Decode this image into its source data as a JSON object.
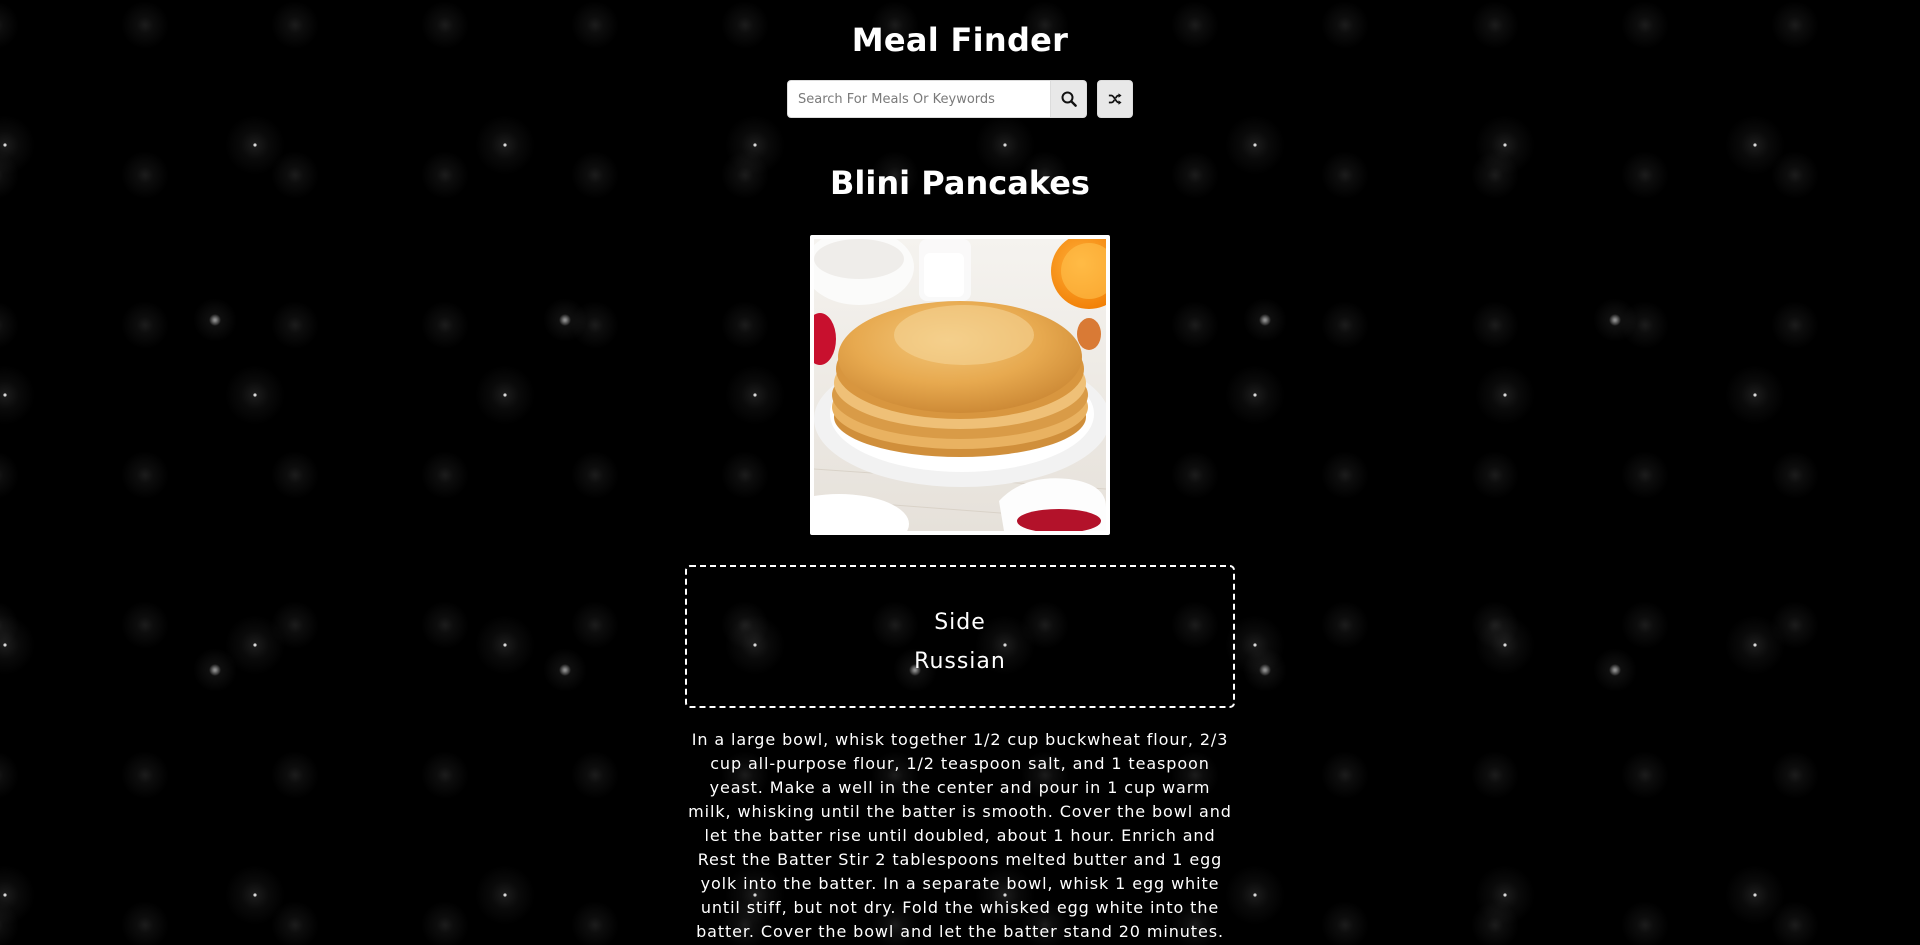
{
  "header": {
    "title": "Meal Finder"
  },
  "search": {
    "placeholder": "Search For Meals Or Keywords",
    "value": "",
    "submit_icon": "search-icon",
    "random_icon": "shuffle-icon"
  },
  "meal": {
    "name": "Blini Pancakes",
    "image_alt": "Blini Pancakes",
    "category": "Side",
    "area": "Russian",
    "instructions": "In a large bowl, whisk together 1/2 cup buckwheat flour, 2/3 cup all-purpose flour, 1/2 teaspoon salt, and 1 teaspoon yeast. Make a well in the center and pour in 1 cup warm milk, whisking until the batter is smooth. Cover the bowl and let the batter rise until doubled, about 1 hour. Enrich and Rest the Batter Stir 2 tablespoons melted butter and 1 egg yolk into the batter. In a separate bowl, whisk 1 egg white until stiff, but not dry. Fold the whisked egg white into the batter. Cover the bowl and let the batter stand 20 minutes."
  },
  "colors": {
    "background": "#000000",
    "text": "#ffffff",
    "button_bg": "#e8e8e8"
  }
}
